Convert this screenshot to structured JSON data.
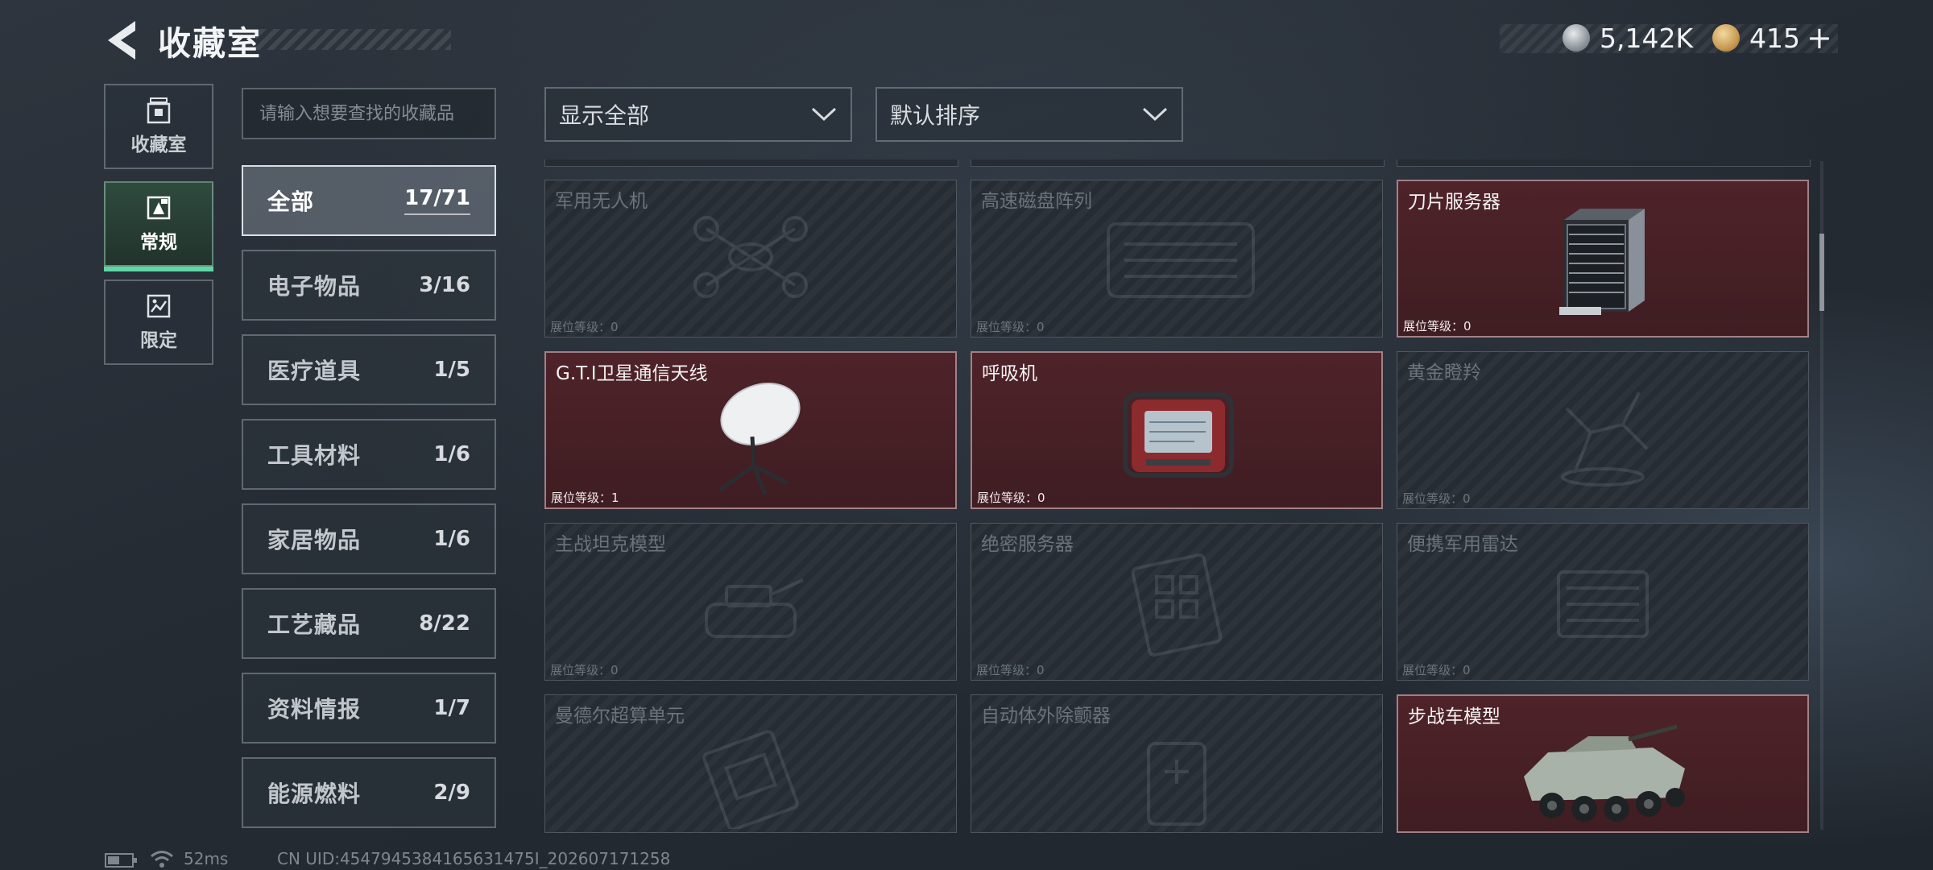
{
  "header": {
    "title": "收藏室",
    "currency_silver": "5,142K",
    "currency_gold": "415",
    "gold_plus": "+"
  },
  "nav": [
    {
      "label": "收藏室",
      "icon": "collection-icon",
      "active": false
    },
    {
      "label": "常规",
      "icon": "regular-icon",
      "active": true
    },
    {
      "label": "限定",
      "icon": "limited-icon",
      "active": false
    }
  ],
  "search": {
    "placeholder": "请输入想要查找的收藏品"
  },
  "categories": [
    {
      "name": "全部",
      "count": "17/71",
      "active": true
    },
    {
      "name": "电子物品",
      "count": "3/16"
    },
    {
      "name": "医疗道具",
      "count": "1/5"
    },
    {
      "name": "工具材料",
      "count": "1/6"
    },
    {
      "name": "家居物品",
      "count": "1/6"
    },
    {
      "name": "工艺藏品",
      "count": "8/22"
    },
    {
      "name": "资料情报",
      "count": "1/7"
    },
    {
      "name": "能源燃料",
      "count": "2/9"
    }
  ],
  "filters": {
    "display": "显示全部",
    "sort": "默认排序"
  },
  "level_label": "展位等级：",
  "items": [
    {
      "name": "军用无人机",
      "level": "0",
      "owned": false,
      "icon": "drone-icon"
    },
    {
      "name": "高速磁盘阵列",
      "level": "0",
      "owned": false,
      "icon": "disk-array-icon"
    },
    {
      "name": "刀片服务器",
      "level": "0",
      "owned": true,
      "icon": "blade-server-icon"
    },
    {
      "name": "G.T.I卫星通信天线",
      "level": "1",
      "owned": true,
      "icon": "satellite-dish-icon"
    },
    {
      "name": "呼吸机",
      "level": "0",
      "owned": true,
      "icon": "ventilator-icon"
    },
    {
      "name": "黄金瞪羚",
      "level": "0",
      "owned": false,
      "icon": "gazelle-icon"
    },
    {
      "name": "主战坦克模型",
      "level": "0",
      "owned": false,
      "icon": "tank-model-icon"
    },
    {
      "name": "绝密服务器",
      "level": "0",
      "owned": false,
      "icon": "secret-server-icon"
    },
    {
      "name": "便携军用雷达",
      "level": "0",
      "owned": false,
      "icon": "radar-icon"
    },
    {
      "name": "曼德尔超算单元",
      "level": "",
      "owned": false,
      "icon": "supercomputer-icon"
    },
    {
      "name": "自动体外除颤器",
      "level": "",
      "owned": false,
      "icon": "defibrillator-icon"
    },
    {
      "name": "步战车模型",
      "level": "",
      "owned": true,
      "icon": "ifv-model-icon"
    }
  ],
  "status": {
    "ping": "52ms",
    "uid": "CN UID:4547945384165631475I_202607171258"
  },
  "colors": {
    "accent": "#5fd6a8",
    "owned_bg": "#4e2329",
    "locked_bg": "#262c33"
  }
}
